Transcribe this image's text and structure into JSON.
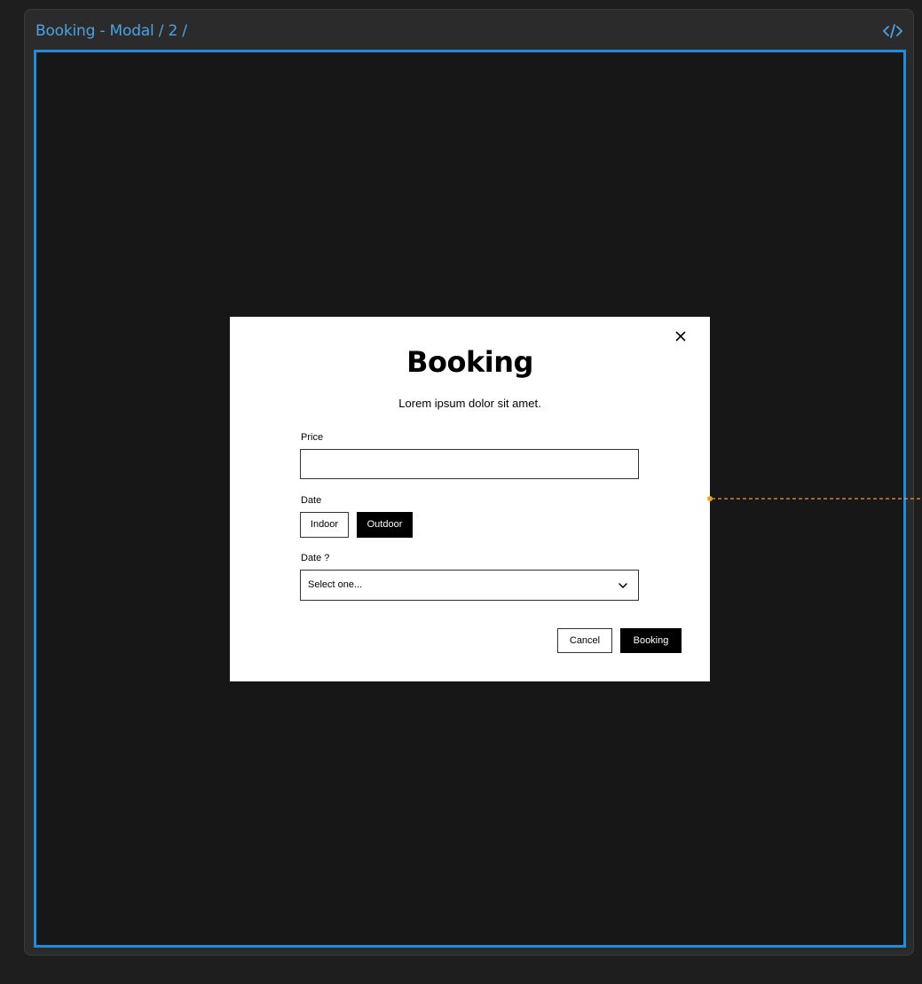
{
  "frame": {
    "title": "Booking - Modal / 2 /",
    "code_icon": "code-icon",
    "accent_color": "#1e8de0",
    "title_color": "#4aa3e4"
  },
  "modal": {
    "title": "Booking",
    "subtitle": "Lorem ipsum dolor sit amet.",
    "close_icon": "close-icon",
    "price": {
      "label": "Price",
      "value": "",
      "placeholder": ""
    },
    "date": {
      "label": "Date",
      "options": [
        "Indoor",
        "Outdoor"
      ],
      "selected": "Outdoor"
    },
    "date_select": {
      "label": "Date ?",
      "value": "Select one...",
      "icon": "chevron-down-icon"
    },
    "actions": {
      "cancel_label": "Cancel",
      "submit_label": "Booking"
    }
  },
  "connector": {
    "color": "#f0a020",
    "style": "dashed"
  }
}
